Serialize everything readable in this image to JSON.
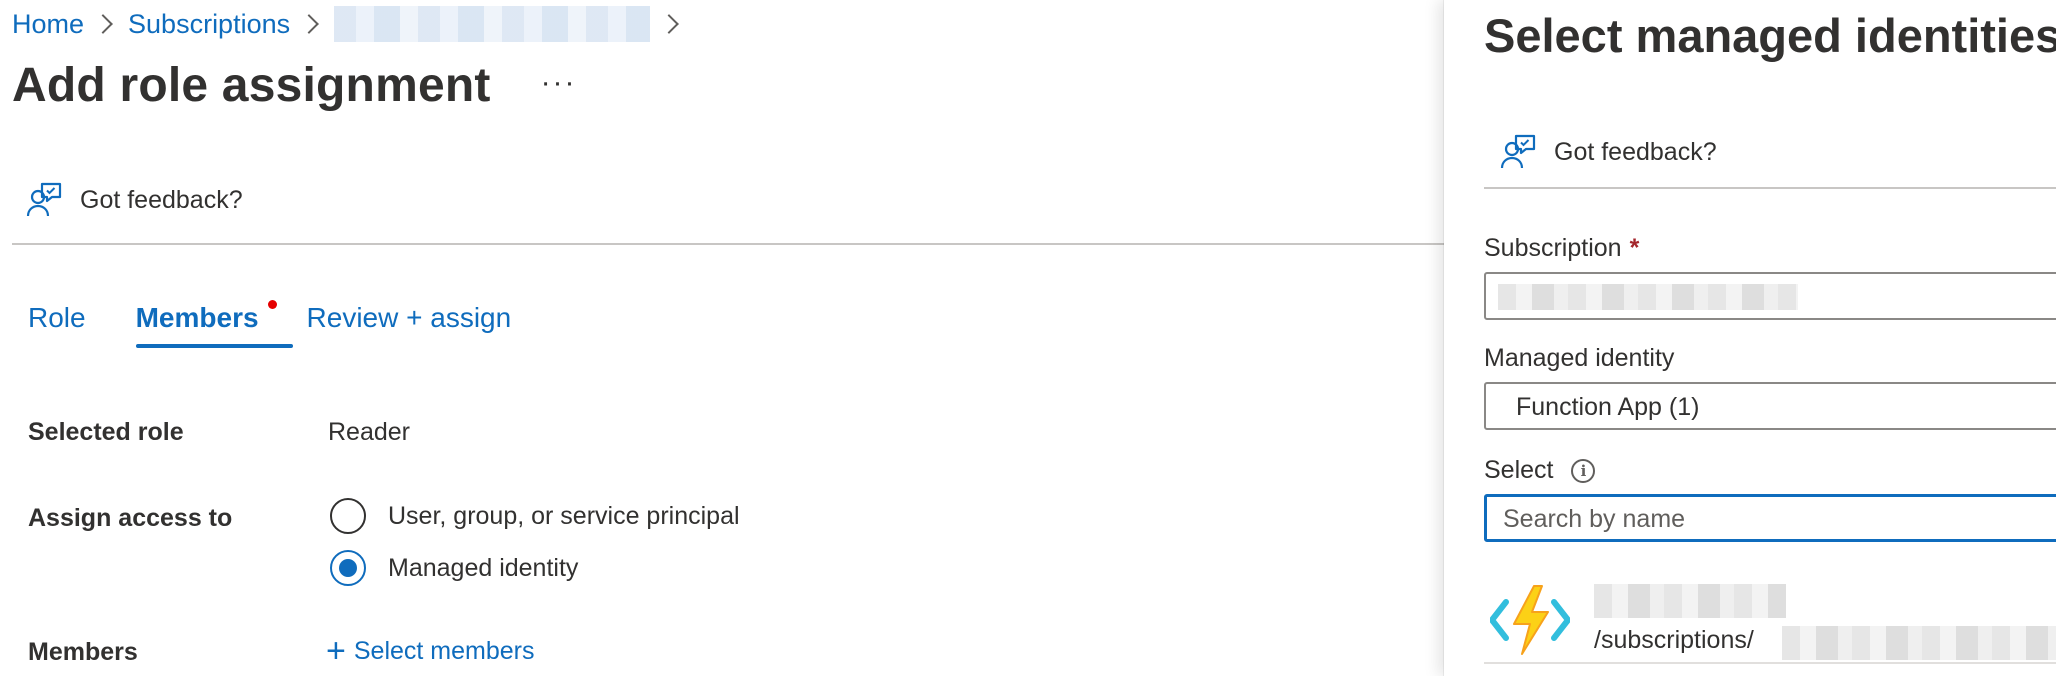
{
  "breadcrumb": {
    "home": "Home",
    "subscriptions": "Subscriptions"
  },
  "page": {
    "title": "Add role assignment",
    "more_label": "···",
    "feedback_label": "Got feedback?"
  },
  "tabs": [
    {
      "label": "Role"
    },
    {
      "label": "Members"
    },
    {
      "label": "Review + assign"
    }
  ],
  "selected_role": {
    "label": "Selected role",
    "value": "Reader"
  },
  "assign_access": {
    "label": "Assign access to",
    "options": [
      {
        "label": "User, group, or service principal",
        "checked": false
      },
      {
        "label": "Managed identity",
        "checked": true
      }
    ]
  },
  "members": {
    "label": "Members",
    "select_link": "Select members"
  },
  "panel": {
    "title": "Select managed identities",
    "feedback_label": "Got feedback?",
    "subscription_label": "Subscription",
    "required_mark": "*",
    "managed_identity_label": "Managed identity",
    "managed_identity_value": "Function App (1)",
    "select_label": "Select",
    "info_glyph": "i",
    "search_placeholder": "Search by name",
    "result_path_prefix": "/subscriptions/"
  },
  "colors": {
    "link_blue": "#0f6cbd",
    "text": "#323130",
    "required_red": "#a4262c",
    "tab_dot": "#e50000",
    "divider": "#c8c6c4"
  },
  "icons": {
    "feedback": "person-feedback-icon",
    "breadcrumb_separator": "chevron-right-icon",
    "function_app": "azure-function-app-icon",
    "info": "info-icon",
    "add": "plus-icon"
  }
}
